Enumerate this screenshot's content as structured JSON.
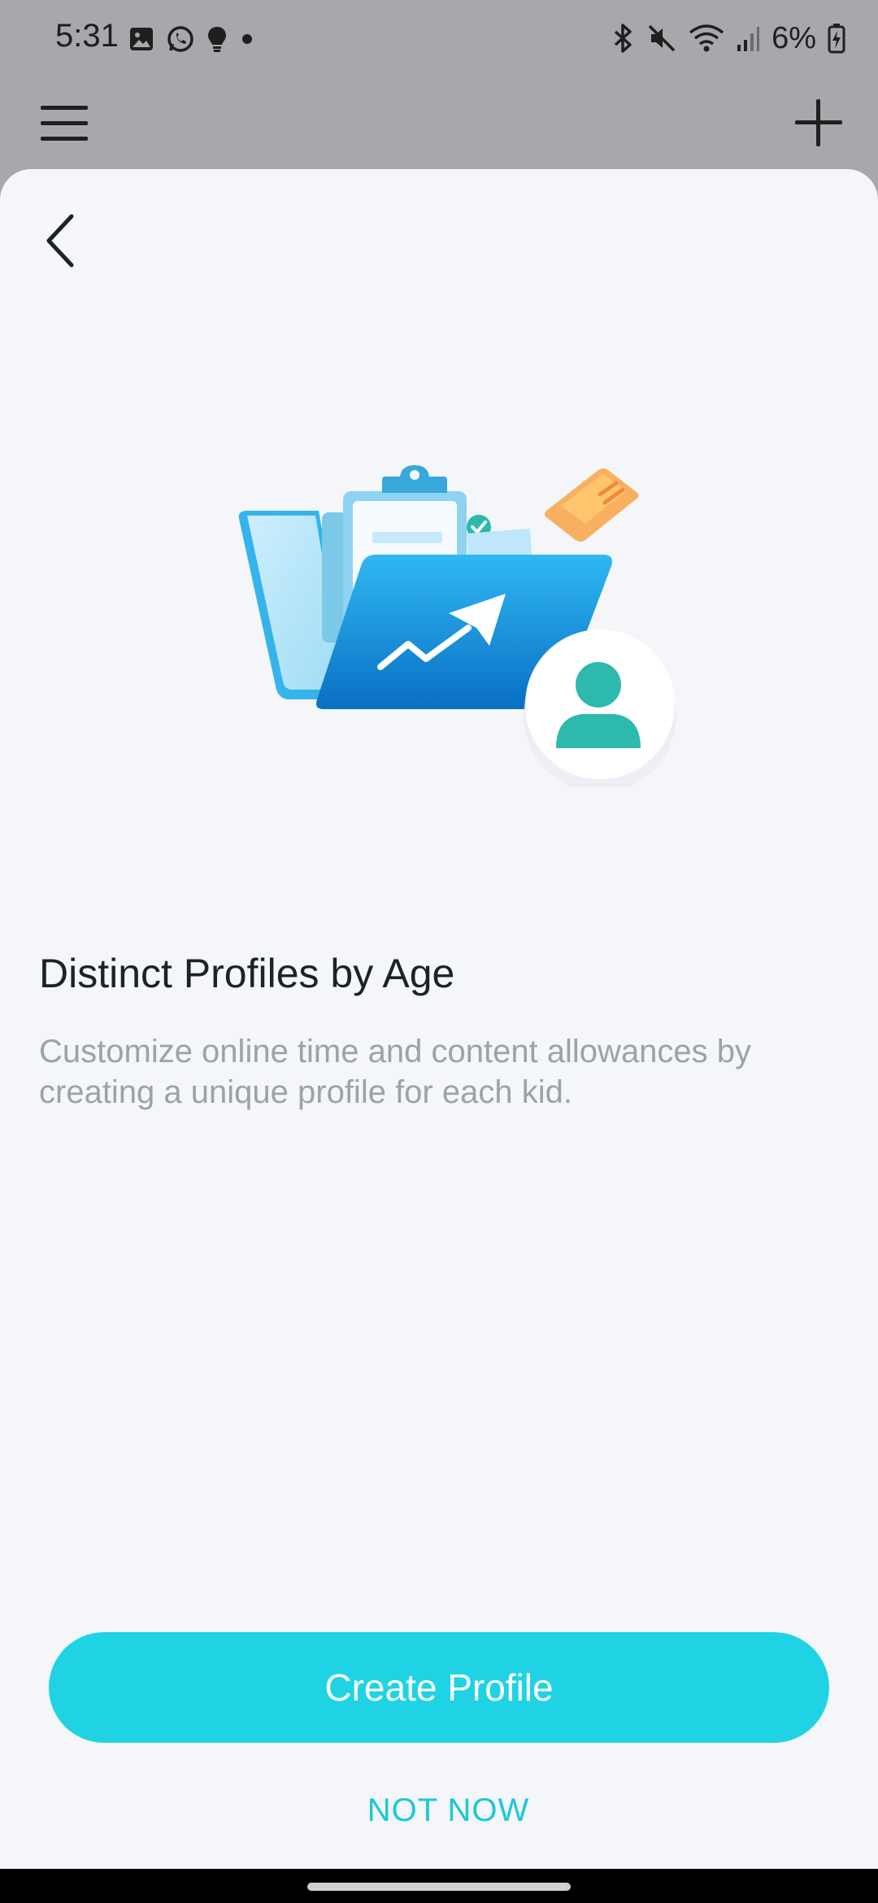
{
  "status_bar": {
    "time": "5:31",
    "left_icons": [
      "gallery-icon",
      "whatsapp-icon",
      "bulb-icon",
      "dot-icon"
    ],
    "right_icons": [
      "bluetooth-icon",
      "mute-icon",
      "wifi-icon",
      "signal-icon",
      "battery-icon"
    ],
    "battery": "6%"
  },
  "app_toolbar": {
    "menu_icon": "menu-icon",
    "add_icon": "plus-icon"
  },
  "sheet": {
    "back_icon": "chevron-left-icon",
    "title": "Distinct Profiles by Age",
    "description": "Customize online time and content allowances by creating a unique profile for each kid.",
    "primary_button": "Create Profile",
    "secondary_button": "NOT NOW"
  },
  "colors": {
    "accent": "#1fd3e5",
    "accent_text": "#1cc7da",
    "sheet_bg": "#f4f6fa",
    "scrim": "#a7a8ab",
    "title": "#1d2128",
    "description": "#9da1a9"
  }
}
